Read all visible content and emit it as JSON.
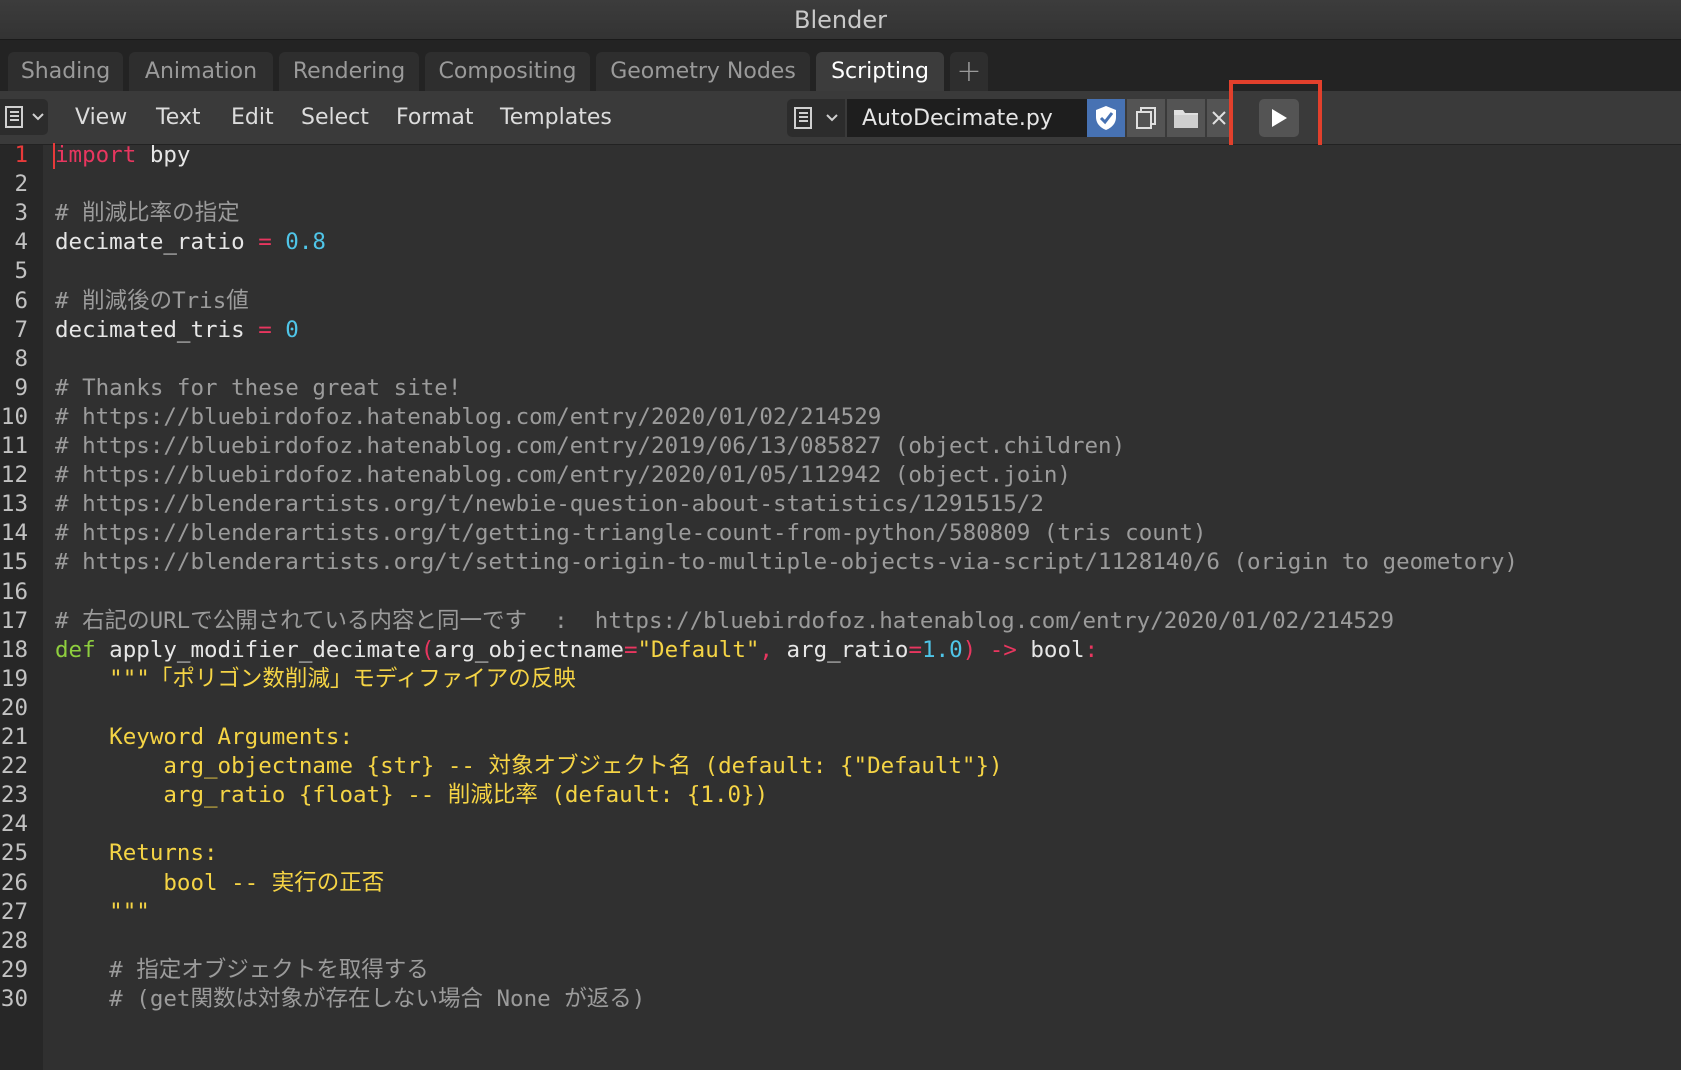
{
  "window": {
    "title": "Blender"
  },
  "workspace_tabs": [
    {
      "label": "Shading"
    },
    {
      "label": "Animation"
    },
    {
      "label": "Rendering"
    },
    {
      "label": "Compositing"
    },
    {
      "label": "Geometry Nodes"
    },
    {
      "label": "Scripting",
      "active": true
    }
  ],
  "add_tab_label": "+",
  "menu": {
    "items": [
      "View",
      "Text",
      "Edit",
      "Select",
      "Format",
      "Templates"
    ]
  },
  "text_block": {
    "file_name": "AutoDecimate.py"
  },
  "icons": {
    "editor_type": "text-editor-icon",
    "dropdown": "chevron-down-icon",
    "shield": "shield-check-icon",
    "duplicate": "copy-icon",
    "open": "folder-icon",
    "unlink": "close-icon",
    "run": "play-icon"
  },
  "colors": {
    "keyword": "#e8365f",
    "def": "#8ece3e",
    "number": "#4fc5e8",
    "string": "#f5d445",
    "comment": "#9b9b9b",
    "highlight_box": "#e2402c"
  },
  "code": {
    "current_line": 1,
    "lines": [
      {
        "n": "1",
        "tokens": [
          {
            "t": "import",
            "c": "kw"
          },
          {
            "t": " bpy",
            "c": "txt"
          }
        ]
      },
      {
        "n": "2",
        "tokens": []
      },
      {
        "n": "3",
        "tokens": [
          {
            "t": "# 削減比率の指定",
            "c": "com"
          }
        ]
      },
      {
        "n": "4",
        "tokens": [
          {
            "t": "decimate_ratio ",
            "c": "txt"
          },
          {
            "t": "=",
            "c": "op"
          },
          {
            "t": " 0.8",
            "c": "num"
          }
        ]
      },
      {
        "n": "5",
        "tokens": []
      },
      {
        "n": "6",
        "tokens": [
          {
            "t": "# 削減後のTris値",
            "c": "com"
          }
        ]
      },
      {
        "n": "7",
        "tokens": [
          {
            "t": "decimated_tris ",
            "c": "txt"
          },
          {
            "t": "=",
            "c": "op"
          },
          {
            "t": " 0",
            "c": "num"
          }
        ]
      },
      {
        "n": "8",
        "tokens": []
      },
      {
        "n": "9",
        "tokens": [
          {
            "t": "# Thanks for these great site!",
            "c": "com"
          }
        ]
      },
      {
        "n": "10",
        "tokens": [
          {
            "t": "# https://bluebirdofoz.hatenablog.com/entry/2020/01/02/214529",
            "c": "com"
          }
        ]
      },
      {
        "n": "11",
        "tokens": [
          {
            "t": "# https://bluebirdofoz.hatenablog.com/entry/2019/06/13/085827 (object.children)",
            "c": "com"
          }
        ]
      },
      {
        "n": "12",
        "tokens": [
          {
            "t": "# https://bluebirdofoz.hatenablog.com/entry/2020/01/05/112942 (object.join)",
            "c": "com"
          }
        ]
      },
      {
        "n": "13",
        "tokens": [
          {
            "t": "# https://blenderartists.org/t/newbie-question-about-statistics/1291515/2",
            "c": "com"
          }
        ]
      },
      {
        "n": "14",
        "tokens": [
          {
            "t": "# https://blenderartists.org/t/getting-triangle-count-from-python/580809 (tris count)",
            "c": "com"
          }
        ]
      },
      {
        "n": "15",
        "tokens": [
          {
            "t": "# https://blenderartists.org/t/setting-origin-to-multiple-objects-via-script/1128140/6 (origin to geometory)",
            "c": "com"
          }
        ]
      },
      {
        "n": "16",
        "tokens": []
      },
      {
        "n": "17",
        "tokens": [
          {
            "t": "# 右記のURLで公開されている内容と同一です  :  https://bluebirdofoz.hatenablog.com/entry/2020/01/02/214529",
            "c": "com"
          }
        ]
      },
      {
        "n": "18",
        "tokens": [
          {
            "t": "def",
            "c": "def"
          },
          {
            "t": " apply_modifier_decimate",
            "c": "txt"
          },
          {
            "t": "(",
            "c": "op"
          },
          {
            "t": "arg_objectname",
            "c": "txt"
          },
          {
            "t": "=",
            "c": "op"
          },
          {
            "t": "\"Default\"",
            "c": "str"
          },
          {
            "t": ", ",
            "c": "op"
          },
          {
            "t": "arg_ratio",
            "c": "txt"
          },
          {
            "t": "=",
            "c": "op"
          },
          {
            "t": "1.0",
            "c": "num"
          },
          {
            "t": ") -> ",
            "c": "op"
          },
          {
            "t": "bool",
            "c": "txt"
          },
          {
            "t": ":",
            "c": "op"
          }
        ]
      },
      {
        "n": "19",
        "tokens": [
          {
            "t": "    \"\"\"「ポリゴン数削減」モディファイアの反映",
            "c": "str"
          }
        ]
      },
      {
        "n": "20",
        "tokens": []
      },
      {
        "n": "21",
        "tokens": [
          {
            "t": "    Keyword Arguments:",
            "c": "str"
          }
        ]
      },
      {
        "n": "22",
        "tokens": [
          {
            "t": "        arg_objectname {str} -- 対象オブジェクト名 (default: {\"Default\"})",
            "c": "str"
          }
        ]
      },
      {
        "n": "23",
        "tokens": [
          {
            "t": "        arg_ratio {float} -- 削減比率 (default: {1.0})",
            "c": "str"
          }
        ]
      },
      {
        "n": "24",
        "tokens": []
      },
      {
        "n": "25",
        "tokens": [
          {
            "t": "    Returns:",
            "c": "str"
          }
        ]
      },
      {
        "n": "26",
        "tokens": [
          {
            "t": "        bool -- 実行の正否",
            "c": "str"
          }
        ]
      },
      {
        "n": "27",
        "tokens": [
          {
            "t": "    \"\"\"",
            "c": "str"
          }
        ]
      },
      {
        "n": "28",
        "tokens": []
      },
      {
        "n": "29",
        "tokens": [
          {
            "t": "    # 指定オブジェクトを取得する",
            "c": "com"
          }
        ]
      },
      {
        "n": "30",
        "tokens": [
          {
            "t": "    # (get関数は対象が存在しない場合 None が返る)",
            "c": "com"
          }
        ]
      }
    ]
  }
}
